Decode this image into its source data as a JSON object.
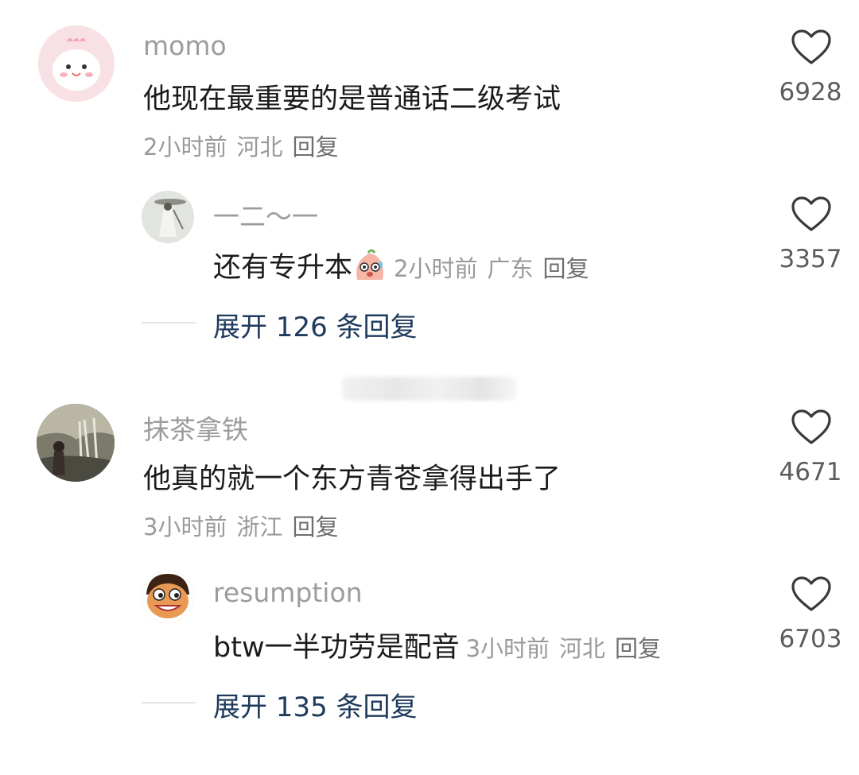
{
  "comments": [
    {
      "username": "momo",
      "text": "他现在最重要的是普通话二级考试",
      "time": "2小时前",
      "location": "河北",
      "reply_label": "回复",
      "likes": "6928",
      "replies": [
        {
          "username": "一二～一",
          "text": "还有专升本",
          "time": "2小时前",
          "location": "广东",
          "reply_label": "回复",
          "likes": "3357"
        }
      ],
      "expand_label": "展开 126 条回复"
    },
    {
      "username": "抹茶拿铁",
      "text": "他真的就一个东方青苍拿得出手了",
      "time": "3小时前",
      "location": "浙江",
      "reply_label": "回复",
      "likes": "4671",
      "replies": [
        {
          "username": "resumption",
          "text": "btw一半功劳是配音",
          "time": "3小时前",
          "location": "河北",
          "reply_label": "回复",
          "likes": "6703"
        }
      ],
      "expand_label": "展开 135 条回复"
    }
  ],
  "icons": {
    "like": "heart-outline-icon",
    "emoji": "sweat-face-emoji-icon"
  },
  "colors": {
    "username": "#9c9c9c",
    "text": "#1b1b1b",
    "meta": "#9a9a9a",
    "expand": "#1e3a5c"
  }
}
